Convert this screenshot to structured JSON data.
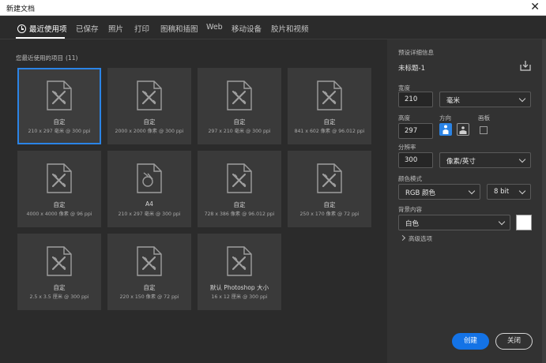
{
  "window": {
    "title": "新建文档",
    "close_glyph": "✕"
  },
  "tabs": [
    {
      "label": "最近使用项",
      "active": true,
      "icon": "clock-icon"
    },
    {
      "label": "已保存"
    },
    {
      "label": "照片"
    },
    {
      "label": "打印"
    },
    {
      "label": "图稿和插图"
    },
    {
      "label": "Web"
    },
    {
      "label": "移动设备"
    },
    {
      "label": "胶片和视频"
    }
  ],
  "recent": {
    "heading": "您最近使用的项目",
    "count": "(11)",
    "items": [
      {
        "name": "自定",
        "size": "210 x 297 毫米 @ 300 ppi",
        "icon": "custom-document-icon",
        "selected": true
      },
      {
        "name": "自定",
        "size": "2000 x 2000 像素 @ 300 ppi",
        "icon": "custom-document-icon"
      },
      {
        "name": "自定",
        "size": "297 x 210 毫米 @ 300 ppi",
        "icon": "custom-document-icon"
      },
      {
        "name": "自定",
        "size": "841 x 602 像素 @ 96.012 ppi",
        "icon": "custom-document-icon"
      },
      {
        "name": "自定",
        "size": "4000 x 4000 像素 @ 96 ppi",
        "icon": "custom-document-icon"
      },
      {
        "name": "A4",
        "size": "210 x 297 毫米 @ 300 ppi",
        "icon": "print-document-icon"
      },
      {
        "name": "自定",
        "size": "728 x 386 像素 @ 96.012 ppi",
        "icon": "custom-document-icon"
      },
      {
        "name": "自定",
        "size": "250 x 170 像素 @ 72 ppi",
        "icon": "custom-document-icon"
      },
      {
        "name": "自定",
        "size": "2.5 x 3.5 厘米 @ 300 ppi",
        "icon": "custom-document-icon"
      },
      {
        "name": "自定",
        "size": "220 x 150 像素 @ 72 ppi",
        "icon": "custom-document-icon"
      },
      {
        "name": "默认 Photoshop 大小",
        "size": "16 x 12 厘米 @ 300 ppi",
        "icon": "custom-document-icon"
      }
    ]
  },
  "details": {
    "heading": "预设详细信息",
    "doc_name": "未标题-1",
    "width_label": "宽度",
    "width_value": "210",
    "width_unit": "毫米",
    "height_label": "高度",
    "height_value": "297",
    "orientation_label": "方向",
    "artboard_label": "画板",
    "resolution_label": "分辨率",
    "resolution_value": "300",
    "resolution_unit": "像素/英寸",
    "color_mode_label": "颜色模式",
    "color_mode_value": "RGB 颜色",
    "bit_depth_value": "8 bit",
    "background_label": "背景内容",
    "background_value": "白色",
    "background_color": "#ffffff",
    "advanced_label": "高级选项"
  },
  "buttons": {
    "create": "创建",
    "close": "关闭"
  },
  "colors": {
    "accent": "#1473e6",
    "selection": "#2b84e6"
  }
}
